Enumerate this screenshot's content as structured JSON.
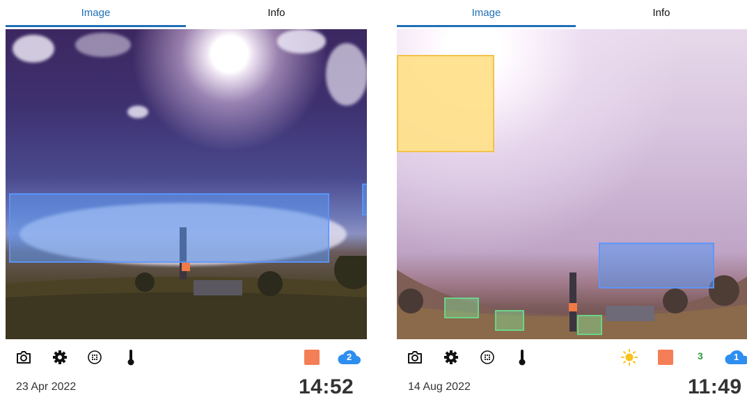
{
  "colors": {
    "accent": "#1f6fb5",
    "orange_status": "#f47e55",
    "cloud_badge": "#2e8ef0",
    "green_count": "#2a9a3a",
    "sun_icon": "#f7c21a",
    "box_blue": "#5a96f0",
    "box_yellow": "#ffe08c",
    "box_green": "#82dc96"
  },
  "panels": [
    {
      "tabs": [
        {
          "label": "Image",
          "active": true
        },
        {
          "label": "Info",
          "active": false
        }
      ],
      "toolbar": {
        "left_icons": [
          "camera-icon",
          "gear-icon",
          "dots-circle-icon",
          "thermometer-icon"
        ],
        "right_items": [
          "orange-square",
          "cloud-badge-icon"
        ],
        "cloud_badge_count": "2"
      },
      "date": "23 Apr 2022",
      "time": "14:52"
    },
    {
      "tabs": [
        {
          "label": "Image",
          "active": true
        },
        {
          "label": "Info",
          "active": false
        }
      ],
      "toolbar": {
        "left_icons": [
          "camera-icon",
          "gear-icon",
          "dots-circle-icon",
          "thermometer-icon"
        ],
        "right_items": [
          "sun-icon",
          "orange-square",
          "green-count",
          "cloud-badge-icon"
        ],
        "green_count": "3",
        "cloud_badge_count": "1"
      },
      "date": "14 Aug 2022",
      "time": "11:49"
    }
  ]
}
